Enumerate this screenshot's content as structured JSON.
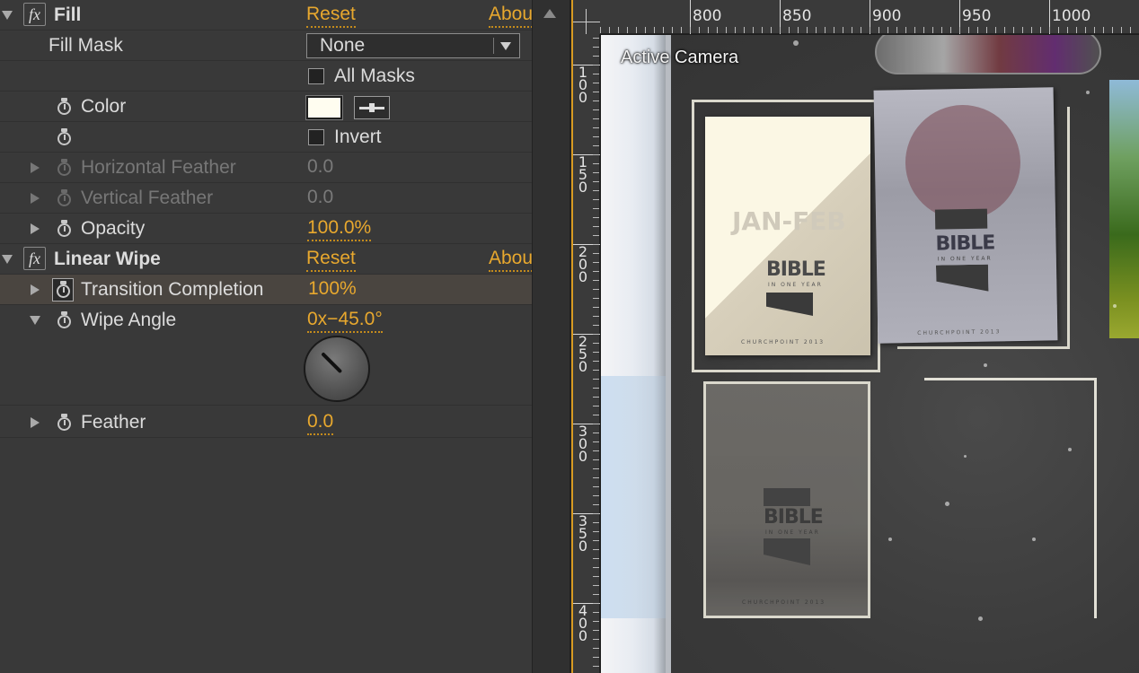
{
  "effects": {
    "fill": {
      "name": "Fill",
      "reset": "Reset",
      "about": "Abou",
      "fill_mask_label": "Fill Mask",
      "fill_mask_value": "None",
      "all_masks_label": "All Masks",
      "color_label": "Color",
      "color_value": "#fffdf0",
      "invert_label": "Invert",
      "horizontal_feather_label": "Horizontal Feather",
      "horizontal_feather_value": "0.0",
      "vertical_feather_label": "Vertical Feather",
      "vertical_feather_value": "0.0",
      "opacity_label": "Opacity",
      "opacity_value": "100.0%"
    },
    "linear_wipe": {
      "name": "Linear Wipe",
      "reset": "Reset",
      "about": "Abou",
      "transition_completion_label": "Transition Completion",
      "transition_completion_value": "100%",
      "wipe_angle_label": "Wipe Angle",
      "wipe_angle_value": "0x−45.0°",
      "feather_label": "Feather",
      "feather_value": "0.0"
    }
  },
  "viewer": {
    "camera_label": "Active Camera",
    "h_ruler_labels": [
      "800",
      "850",
      "900",
      "950",
      "1000"
    ],
    "v_ruler_labels": [
      "100",
      "150",
      "200",
      "250",
      "300",
      "350",
      "400"
    ]
  },
  "cards": {
    "card1_title": "JAN-FEB",
    "card1_word": "BIBLE",
    "card1_sub": "IN ONE YEAR",
    "card1_footer": "CHURCHPOINT 2013",
    "card2_word": "BIBLE",
    "card2_sub": "IN ONE YEAR",
    "card2_footer": "CHURCHPOINT 2013",
    "card4_word": "BIBLE",
    "card4_sub": "IN ONE YEAR",
    "card4_footer": "CHURCHPOINT 2013"
  },
  "colors": {
    "accent": "#e8a82e",
    "panel_bg": "#393939",
    "highlight_row": "#4a4540"
  }
}
